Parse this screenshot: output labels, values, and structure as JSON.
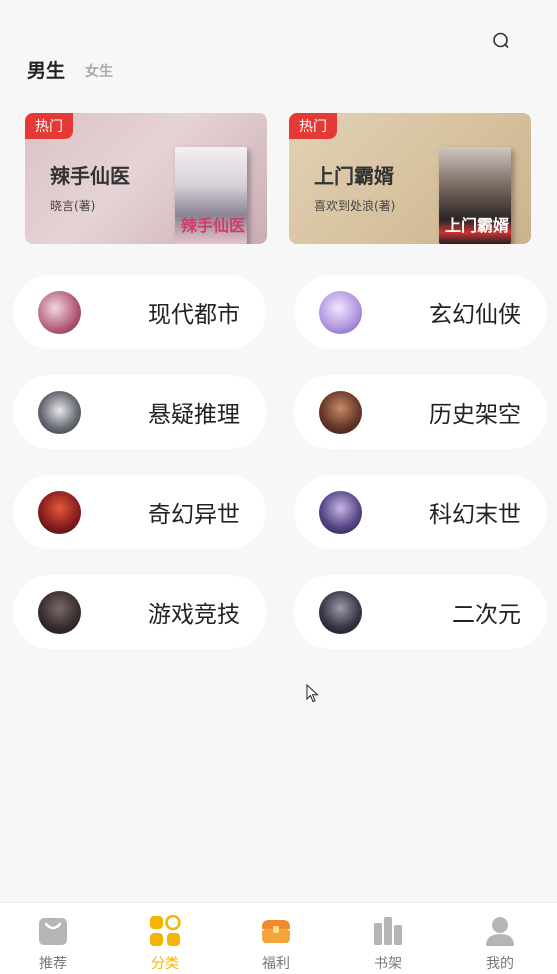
{
  "header": {
    "tab_male": "男生",
    "tab_female": "女生",
    "search_icon": "search-icon"
  },
  "banners": [
    {
      "badge": "热门",
      "title": "辣手仙医",
      "author": "晓言(著)",
      "cover_text": "辣手仙医"
    },
    {
      "badge": "热门",
      "title": "上门霸婿",
      "author": "喜欢到处浪(著)",
      "cover_text": "上门霸婿"
    }
  ],
  "categories": [
    {
      "label": "现代都市"
    },
    {
      "label": "玄幻仙侠"
    },
    {
      "label": "悬疑推理"
    },
    {
      "label": "历史架空"
    },
    {
      "label": "奇幻异世"
    },
    {
      "label": "科幻末世"
    },
    {
      "label": "游戏竞技"
    },
    {
      "label": "二次元"
    }
  ],
  "tabbar": {
    "items": [
      {
        "label": "推荐",
        "icon": "bag-icon"
      },
      {
        "label": "分类",
        "icon": "grid-icon"
      },
      {
        "label": "福利",
        "icon": "treasure-chest-icon"
      },
      {
        "label": "书架",
        "icon": "bookshelf-icon"
      },
      {
        "label": "我的",
        "icon": "user-icon"
      }
    ],
    "active_index": 1
  },
  "colors": {
    "accent": "#f5b400",
    "hot_badge": "#e53935",
    "background": "#f7f7f7",
    "card": "#ffffff"
  }
}
